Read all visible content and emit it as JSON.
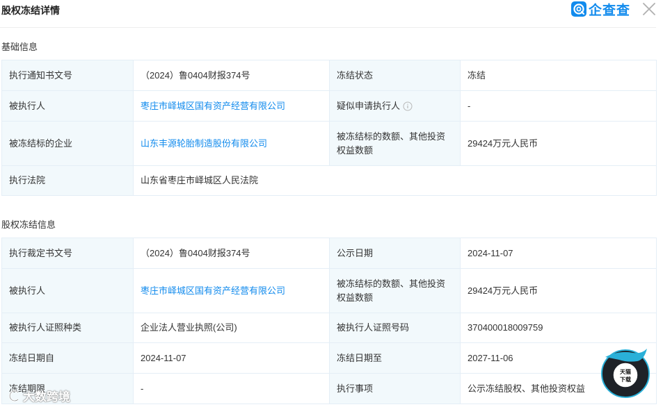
{
  "header": {
    "title": "股权冻结详情",
    "brand_name": "企查查",
    "brand_color": "#128bed"
  },
  "basic": {
    "section_title": "基础信息",
    "rows": [
      [
        {
          "label": "执行通知书文号",
          "value": "（2024）鲁0404财报374号"
        },
        {
          "label": "冻结状态",
          "value": "冻结"
        }
      ],
      [
        {
          "label": "被执行人",
          "value": "枣庄市峄城区国有资产经营有限公司",
          "link": true
        },
        {
          "label": "疑似申请执行人",
          "value": "-",
          "info_icon": true
        }
      ],
      [
        {
          "label": "被冻结标的企业",
          "value": "山东丰源轮胎制造股份有限公司",
          "link": true
        },
        {
          "label": "被冻结标的数额、其他投资权益数额",
          "value": "29424万元人民币"
        }
      ],
      [
        {
          "label": "执行法院",
          "value": "山东省枣庄市峄城区人民法院",
          "colspan": 3
        }
      ]
    ]
  },
  "freeze": {
    "section_title": "股权冻结信息",
    "rows": [
      [
        {
          "label": "执行裁定书文号",
          "value": "（2024）鲁0404财报374号"
        },
        {
          "label": "公示日期",
          "value": "2024-11-07"
        }
      ],
      [
        {
          "label": "被执行人",
          "value": "枣庄市峄城区国有资产经营有限公司",
          "link": true
        },
        {
          "label": "被冻结标的数额、其他投资权益数额",
          "value": "29424万元人民币"
        }
      ],
      [
        {
          "label": "被执行人证照种类",
          "value": "企业法人营业执照(公司)"
        },
        {
          "label": "被执行人证照号码",
          "value": "370400018009759"
        }
      ],
      [
        {
          "label": "冻结日期自",
          "value": "2024-11-07"
        },
        {
          "label": "冻结日期至",
          "value": "2027-11-06"
        }
      ],
      [
        {
          "label": "冻结期限",
          "value": "-"
        },
        {
          "label": "执行事项",
          "value": "公示冻结股权、其他投资权益"
        }
      ]
    ]
  },
  "watermark": {
    "text": "大数跨境"
  },
  "badge": {
    "text": "天猫下载"
  }
}
